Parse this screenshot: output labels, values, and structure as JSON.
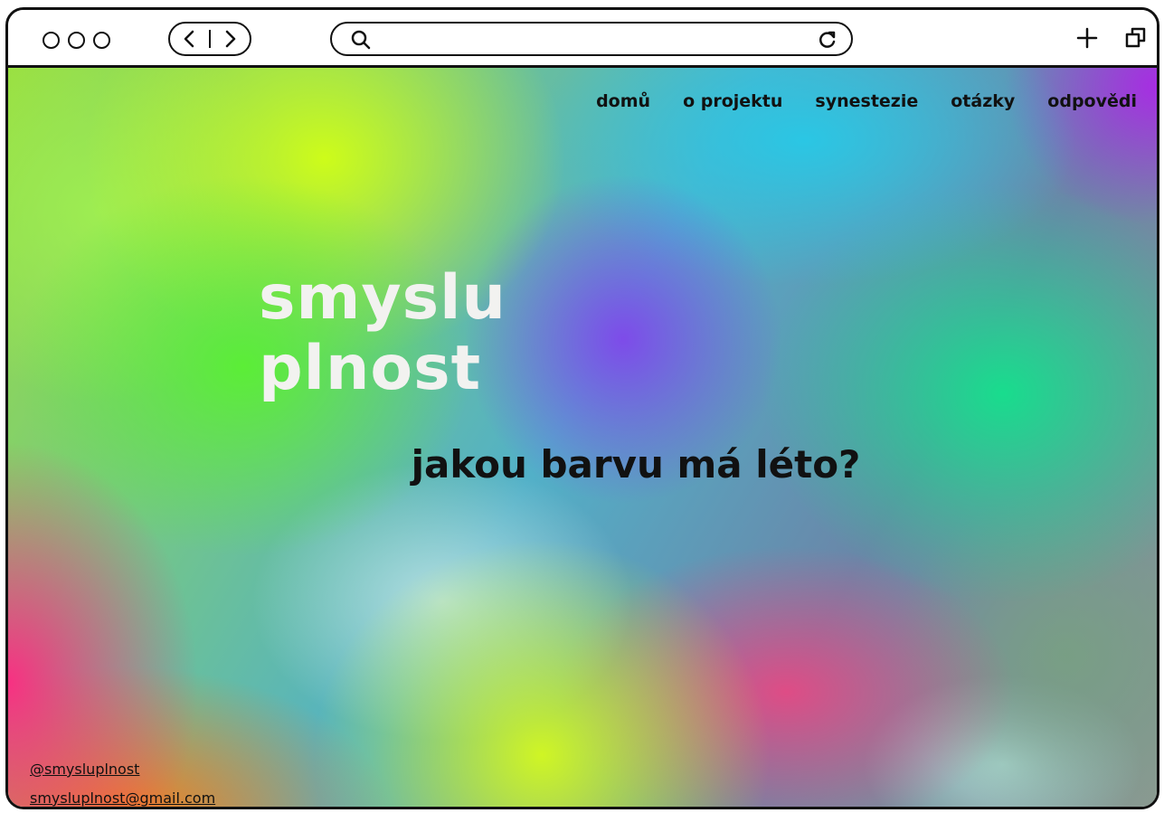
{
  "browser": {
    "address_value": "",
    "icons": [
      "window-dots-icon",
      "back-icon",
      "forward-icon",
      "search-icon",
      "reload-icon",
      "new-tab-icon",
      "windows-icon"
    ]
  },
  "nav": {
    "items": [
      "domů",
      "o projektu",
      "synestezie",
      "otázky",
      "odpovědi"
    ]
  },
  "hero": {
    "logo_line1": "smyslu",
    "logo_line2": "plnost",
    "tagline": "jakou barvu má léto?"
  },
  "contacts": {
    "instagram": "@smysluplnost ",
    "email": "smysluplnost@gmail.com"
  },
  "colors": {
    "text": "#111111",
    "logo": "#f2f2f0",
    "frame": "#111111"
  }
}
